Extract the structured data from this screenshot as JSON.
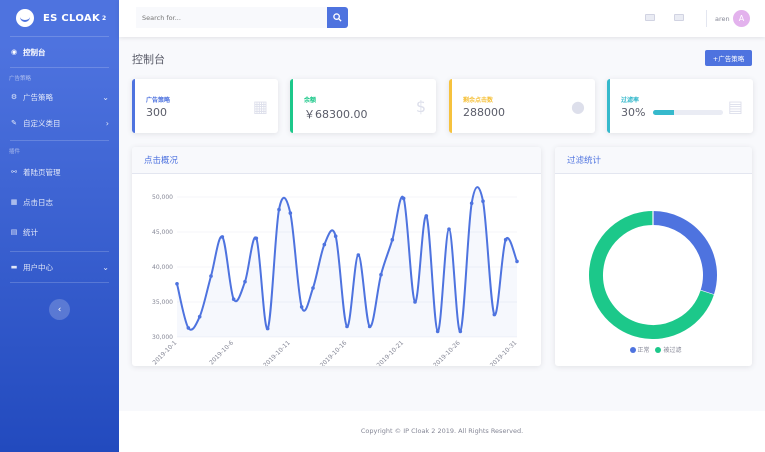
{
  "brand": {
    "name": "ES CLOAK",
    "sup": "2"
  },
  "sidebar": {
    "dashboard": "控制台",
    "heading_ads": "广告策略",
    "items_ads": [
      {
        "label": "广告策略",
        "icon": "gear-icon"
      },
      {
        "label": "自定义类目",
        "icon": "wrench-icon"
      }
    ],
    "heading_plugins": "插件",
    "items_plugins": [
      {
        "label": "着陆页管理",
        "icon": "link-icon"
      },
      {
        "label": "点击日志",
        "icon": "table-icon"
      },
      {
        "label": "统计",
        "icon": "chart-icon"
      }
    ],
    "user_center": "用户中心"
  },
  "topbar": {
    "search_placeholder": "Search for...",
    "username": "aren",
    "avatar_initial": "A"
  },
  "page": {
    "title": "控制台",
    "add_button": "+广告策略"
  },
  "stats": [
    {
      "label": "广告策略",
      "value": "300",
      "color": "#4e73df",
      "icon": "calendar-icon"
    },
    {
      "label": "余额",
      "value": "￥68300.00",
      "color": "#1cc88a",
      "icon": "dollar-icon"
    },
    {
      "label": "剩余点击数",
      "value": "288000",
      "color": "#f6c23e",
      "icon": "comments-icon"
    },
    {
      "label": "过滤率",
      "value": "30%",
      "progress": 0.3,
      "color": "#36b9cc",
      "icon": "clipboard-icon"
    }
  ],
  "click_panel": {
    "title": "点击概况"
  },
  "filter_panel": {
    "title": "过滤统计"
  },
  "footer": {
    "text": "Copyright © IP Cloak 2 2019. All Rights Reserved."
  },
  "chart_data": [
    {
      "type": "line",
      "title": "点击概况",
      "x": [
        "2019-10-1",
        "2019-10-2",
        "2019-10-3",
        "2019-10-4",
        "2019-10-5",
        "2019-10-6",
        "2019-10-7",
        "2019-10-8",
        "2019-10-9",
        "2019-10-10",
        "2019-10-11",
        "2019-10-12",
        "2019-10-13",
        "2019-10-14",
        "2019-10-15",
        "2019-10-16",
        "2019-10-17",
        "2019-10-18",
        "2019-10-19",
        "2019-10-20",
        "2019-10-21",
        "2019-10-22",
        "2019-10-23",
        "2019-10-24",
        "2019-10-25",
        "2019-10-26",
        "2019-10-27",
        "2019-10-28",
        "2019-10-29",
        "2019-10-30",
        "2019-10-31"
      ],
      "x_tick_labels": [
        "2019-10-1",
        "2019-10-6",
        "2019-10-11",
        "2019-10-16",
        "2019-10-21",
        "2019-10-26",
        "2019-10-31"
      ],
      "values": [
        37600,
        31300,
        32900,
        38700,
        44300,
        35400,
        37900,
        44100,
        31200,
        48200,
        47700,
        34300,
        37000,
        43200,
        44400,
        31500,
        41700,
        31500,
        38900,
        43900,
        49800,
        35000,
        47300,
        30800,
        45400,
        30800,
        49100,
        49400,
        33200,
        43900,
        40800
      ],
      "ylim": [
        30000,
        50000
      ],
      "yticks": [
        "30,000",
        "35,000",
        "40,000",
        "45,000",
        "50,000"
      ],
      "color": "#4e73df",
      "grid": true
    },
    {
      "type": "pie",
      "title": "过滤统计",
      "labels": [
        "正常",
        "被过滤"
      ],
      "values": [
        30,
        70
      ],
      "colors": [
        "#4e73df",
        "#1cc88a"
      ],
      "legend": "bottom"
    }
  ]
}
